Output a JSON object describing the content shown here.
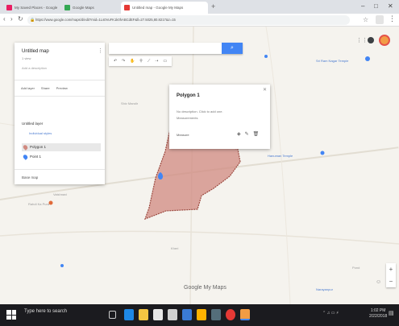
{
  "browser": {
    "tabs": [
      {
        "label": "My Saved Places - Google",
        "active": false,
        "color": "#e91e63"
      },
      {
        "label": "Google Maps",
        "active": false,
        "color": "#34a853"
      },
      {
        "label": "Untitled map - Google My Maps",
        "active": true,
        "color": "#e53935"
      }
    ],
    "new_tab": "+",
    "url": "https://www.google.com/maps/d/edit?mid=1Ls0VuFK1k0hABCdEF&ll=27.5025,80.8217&z=15",
    "window_controls": [
      "–",
      "□",
      "✕"
    ]
  },
  "map": {
    "search_button": "search",
    "toolbar_icons": [
      "undo",
      "redo",
      "select",
      "marker",
      "line",
      "route",
      "ruler"
    ],
    "labels": [
      "Sri Ram Nagar Temple",
      "Shiv Mandir",
      "Madhav Nagar",
      "Hanuman Temple",
      "Gudri Ka Nadia",
      "Vaishnavi",
      "Rahdi Ka Pura",
      "Kheri",
      "Pond",
      "Narayanpur"
    ],
    "brand": "Google My Maps",
    "attribution": "Map data ©2018 Google"
  },
  "panel": {
    "title": "Untitled map",
    "subtitle": "1 view",
    "description": "Add a description",
    "actions": [
      "Add layer",
      "Share",
      "Preview"
    ],
    "layer_title": "Untitled layer",
    "layer_link": "Individual styles",
    "layer_items": [
      "Polygon 1",
      "Point 1"
    ],
    "base_map": "Base map"
  },
  "card": {
    "title": "Polygon 1",
    "line1": "No description. Click to add one.",
    "line2": "Measurements",
    "foot_left": "Measure",
    "foot_right": "Delete"
  },
  "taskbar": {
    "search": "Type here to search",
    "time": "1:02 PM",
    "date": "2/22/2018"
  },
  "colors": {
    "polygon_fill": "#d08a80",
    "polygon_stroke": "#9c4a40",
    "accent": "#4285f4"
  }
}
